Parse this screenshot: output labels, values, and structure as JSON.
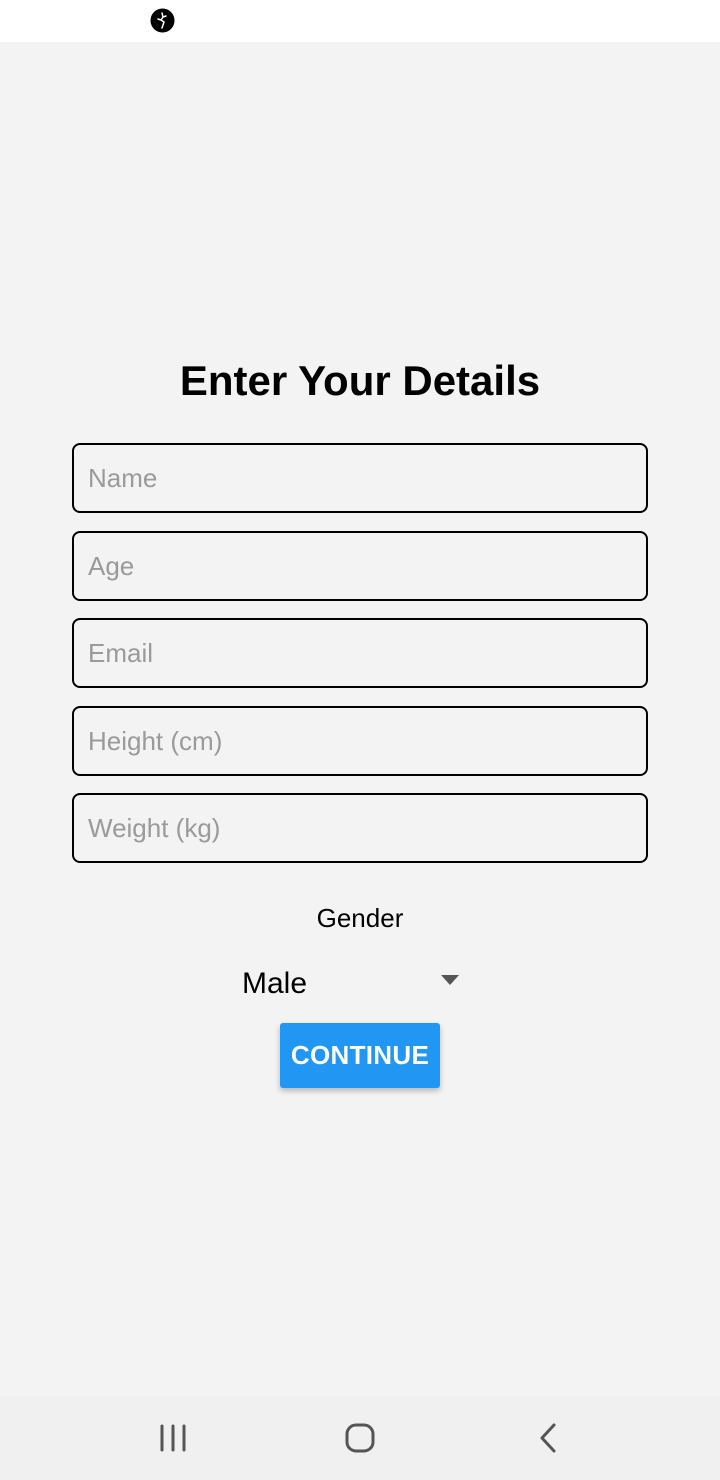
{
  "status_bar": {
    "app_icon": "fairy-icon"
  },
  "form": {
    "title": "Enter Your Details",
    "fields": [
      {
        "placeholder": "Name",
        "value": ""
      },
      {
        "placeholder": "Age",
        "value": ""
      },
      {
        "placeholder": "Email",
        "value": ""
      },
      {
        "placeholder": "Height (cm)",
        "value": ""
      },
      {
        "placeholder": "Weight (kg)",
        "value": ""
      }
    ],
    "gender_label": "Gender",
    "gender_value": "Male",
    "continue_label": "CONTINUE"
  },
  "colors": {
    "background": "#f3f3f3",
    "accent": "#2196f3",
    "placeholder": "#9a9a9a"
  },
  "nav_bar": {
    "icons": [
      "recents-icon",
      "home-icon",
      "back-icon"
    ]
  }
}
